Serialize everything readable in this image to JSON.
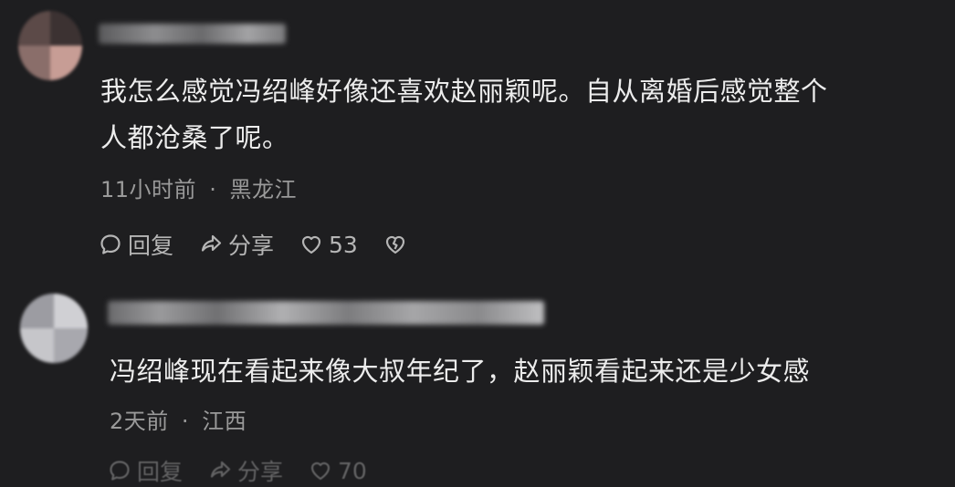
{
  "comments": [
    {
      "text_line1": "我怎么感觉冯绍峰好像还喜欢赵丽颖呢。自从离婚后感觉整个",
      "text_line2": "人都沧桑了呢。",
      "time": "11小时前",
      "separator": "·",
      "location": "黑龙江",
      "reply_label": "回复",
      "share_label": "分享",
      "like_count": "53"
    },
    {
      "text_line1": "冯绍峰现在看起来像大叔年纪了，赵丽颖看起来还是少女感",
      "time": "2天前",
      "separator": "·",
      "location": "江西",
      "reply_label": "回复",
      "share_label": "分享",
      "like_count": "70"
    }
  ],
  "icons": {
    "reply": "chat-bubble-icon",
    "share": "share-arrow-icon",
    "like": "heart-icon",
    "dislike": "broken-heart-icon"
  },
  "colors": {
    "background": "#1e1e20",
    "text": "#ececec",
    "meta": "#9a9a9a",
    "action": "#b5b5b5"
  }
}
